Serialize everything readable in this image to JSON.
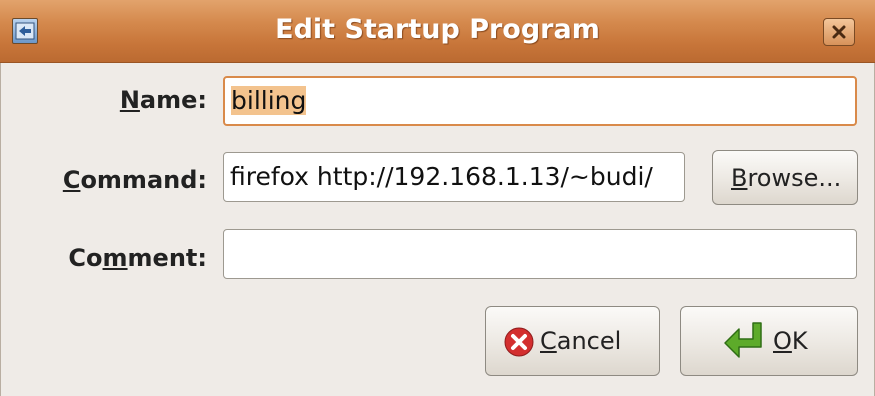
{
  "window": {
    "title": "Edit Startup Program",
    "menu_icon": "window-menu-icon",
    "close_icon": "close-icon"
  },
  "form": {
    "name_label_mnemonic": "N",
    "name_label_rest": "ame:",
    "name_value": "billing",
    "command_label_mnemonic": "C",
    "command_label_rest": "ommand:",
    "command_value": "firefox http://192.168.1.13/~budi/",
    "comment_label_pre": "Co",
    "comment_label_mnemonic": "m",
    "comment_label_rest": "ment:",
    "comment_value": ""
  },
  "buttons": {
    "browse_mnemonic": "B",
    "browse_rest": "rowse...",
    "cancel_mnemonic": "C",
    "cancel_rest": "ancel",
    "ok_mnemonic": "O",
    "ok_rest": "K",
    "cancel_icon": "cancel-icon",
    "ok_icon": "ok-arrow-icon"
  },
  "colors": {
    "titlebar": "#d58a4e",
    "focus_border": "#d98a4a",
    "selection": "#f3c38e",
    "cancel_icon": "#d32f2f",
    "ok_icon": "#5dab2a"
  }
}
